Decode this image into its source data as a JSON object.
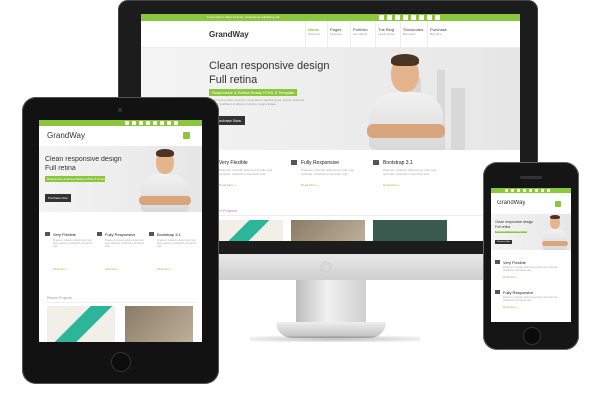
{
  "brand": "GrandWay",
  "topbar_text": "Lorem ipsum dolor sit amet, consectetur adipiscing elit",
  "nav": [
    {
      "label": "Home",
      "sub": "Welcome"
    },
    {
      "label": "Pages",
      "sub": "Features"
    },
    {
      "label": "Portfolio",
      "sub": "Our Works"
    },
    {
      "label": "The Blog",
      "sub": "Latest News"
    },
    {
      "label": "Shortcodes",
      "sub": "Elements"
    },
    {
      "label": "Purchase",
      "sub": "Buy Now"
    }
  ],
  "hero": {
    "line1": "Clean responsive design",
    "line2": "Full retina",
    "badge": "Responsive & Retina Ready HTML 5 Template",
    "body": "Lorem ipsum dolor sit amet, consectetur adipiscing elit, sed do eiusmod tempor incididunt ut labore et dolore magna aliqua.",
    "button": "Purchase Now"
  },
  "features": [
    {
      "title": "Very Flexible",
      "body": "Praesent molestie ullamcorper felis eget vehicula. Vestibulum hendrerit velit.",
      "more": "Read More »"
    },
    {
      "title": "Fully Responsive",
      "body": "Praesent molestie ullamcorper felis eget vehicula. Vestibulum hendrerit velit.",
      "more": "Read More »"
    },
    {
      "title": "Bootstrap 3.1",
      "body": "Praesent molestie ullamcorper felis eget vehicula. Vestibulum hendrerit velit.",
      "more": "Read More »"
    }
  ],
  "recent_projects": "Recent Projects",
  "accent": "#8cc63f"
}
